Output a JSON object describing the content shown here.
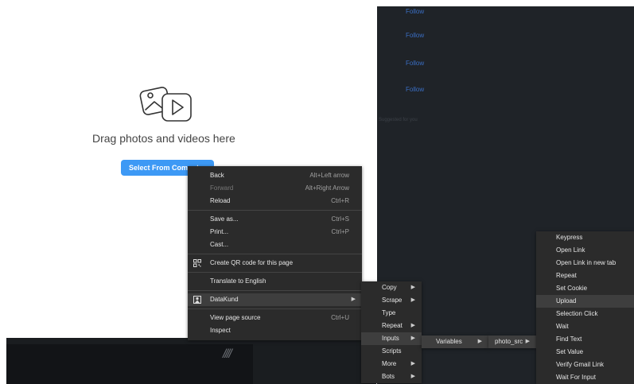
{
  "background_page": {
    "follow_links": [
      "Follow",
      "Follow",
      "Follow",
      "Follow"
    ],
    "faint_text": "Suggested for you",
    "upload": {
      "icon": "photo-video-icon",
      "drag_text": "Drag photos and videos here",
      "select_button_label": "Select From Computer"
    }
  },
  "context_menu": {
    "items": [
      {
        "label": "Back",
        "shortcut": "Alt+Left arrow"
      },
      {
        "label": "Forward",
        "shortcut": "Alt+Right Arrow"
      },
      {
        "label": "Reload",
        "shortcut": "Ctrl+R"
      },
      {
        "label": "Save as...",
        "shortcut": "Ctrl+S"
      },
      {
        "label": "Print...",
        "shortcut": "Ctrl+P"
      },
      {
        "label": "Cast..."
      },
      {
        "label": "Create QR code for this page",
        "icon": "qr-code-icon"
      },
      {
        "label": "Translate to English"
      },
      {
        "label": "DataKund",
        "icon": "datakund-icon"
      },
      {
        "label": "View page source",
        "shortcut": "Ctrl+U"
      },
      {
        "label": "Inspect"
      }
    ]
  },
  "datakund_submenu": {
    "items": [
      "Copy",
      "Scrape",
      "Type",
      "Repeat",
      "Inputs",
      "Scripts",
      "More",
      "Bots"
    ]
  },
  "inputs_submenu": {
    "items": [
      "Variables"
    ]
  },
  "variables_submenu": {
    "items": [
      "photo_src"
    ]
  },
  "actions_submenu": {
    "items": [
      "Keypress",
      "Open Link",
      "Open Link in new tab",
      "Repeat",
      "Set Cookie",
      "Upload",
      "Selection Click",
      "Wait",
      "Find Text",
      "Set Value",
      "Verify Gmail Link",
      "Wait For Input"
    ]
  },
  "colors": {
    "menu_bg": "#2b2b2b",
    "menu_highlight": "#3e3e3e",
    "primary_button": "#3d99f5",
    "dark_page": "#1f2328"
  }
}
